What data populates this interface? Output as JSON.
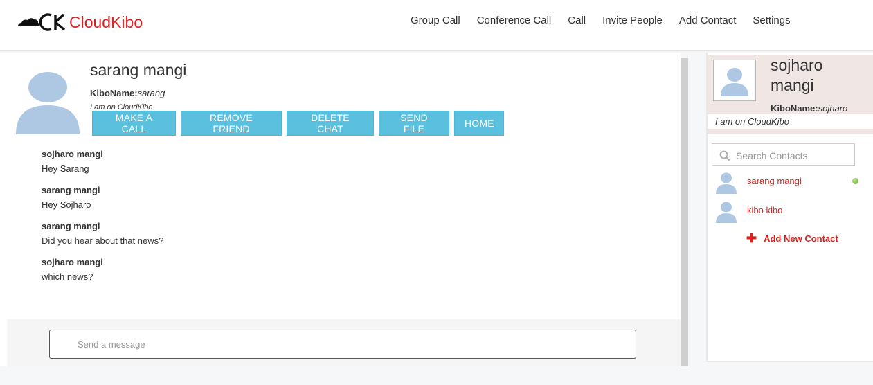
{
  "app": {
    "brand_text": "CloudKibo",
    "brand_mark": "CK",
    "accent_color": "#e02020",
    "button_color": "#5bc0de"
  },
  "nav": {
    "items": [
      {
        "label": "Group Call"
      },
      {
        "label": "Conference Call"
      },
      {
        "label": "Call"
      },
      {
        "label": "Invite People"
      },
      {
        "label": "Add Contact"
      },
      {
        "label": "Settings"
      }
    ]
  },
  "chat": {
    "peer": {
      "name": "sarang mangi",
      "kibo_label": "KiboName:",
      "kibo_name": "sarang",
      "status": "I am on CloudKibo"
    },
    "actions": [
      {
        "label": "MAKE A CALL"
      },
      {
        "label": "REMOVE FRIEND"
      },
      {
        "label": "DELETE CHAT"
      },
      {
        "label": "SEND FILE"
      },
      {
        "label": "HOME"
      }
    ],
    "messages": [
      {
        "sender": "sojharo mangi",
        "text": "Hey Sarang"
      },
      {
        "sender": "sarang mangi",
        "text": "Hey Sojharo"
      },
      {
        "sender": "sarang mangi",
        "text": "Did you hear about that news?"
      },
      {
        "sender": "sojharo mangi",
        "text": "which news?"
      }
    ],
    "composer": {
      "placeholder": "Send a message",
      "value": ""
    }
  },
  "sidebar": {
    "me": {
      "name": "sojharo mangi",
      "kibo_label": "KiboName:",
      "kibo_name": "sojharo",
      "status": "I am on CloudKibo"
    },
    "search": {
      "placeholder": "Search Contacts",
      "icon": "search-icon"
    },
    "contacts": [
      {
        "name": "sarang mangi",
        "online": true
      },
      {
        "name": "kibo kibo",
        "online": false
      }
    ],
    "add_contact_label": "Add New Contact"
  }
}
